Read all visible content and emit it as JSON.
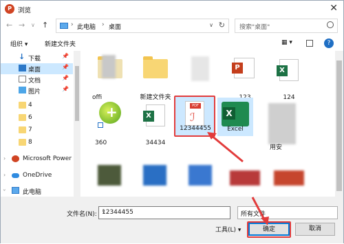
{
  "window": {
    "title": "浏览",
    "app_icon": "P",
    "close": "✕"
  },
  "address": {
    "back": "←",
    "forward": "→",
    "up_dropdown": "∨",
    "up": "↑",
    "crumbs": [
      "此电脑",
      "桌面"
    ],
    "sep": "›",
    "search_placeholder": "搜索\"桌面\""
  },
  "toolbar": {
    "organize": "组织 ▾",
    "new_folder": "新建文件夹",
    "view": "▦ ▾"
  },
  "sidebar": {
    "items": [
      {
        "label": "下载",
        "pinned": true
      },
      {
        "label": "桌面",
        "pinned": true,
        "selected": true
      },
      {
        "label": "文档",
        "pinned": true
      },
      {
        "label": "图片",
        "pinned": true
      },
      {
        "label": "4"
      },
      {
        "label": "6"
      },
      {
        "label": "7"
      },
      {
        "label": "8"
      },
      {
        "label": "Microsoft Power"
      },
      {
        "label": "OneDrive"
      },
      {
        "label": "此电脑"
      }
    ]
  },
  "files": [
    {
      "label": "offi"
    },
    {
      "label": "新建文件夹"
    },
    {
      "label": ""
    },
    {
      "label": "123"
    },
    {
      "label": "124"
    },
    {
      "label": "360"
    },
    {
      "label": "34434"
    },
    {
      "label": "12344455",
      "selected": true
    },
    {
      "label": "Excel"
    },
    {
      "label": "用安"
    }
  ],
  "bottom": {
    "filename_label": "文件名(N):",
    "filename_value": "12344455",
    "filter": "所有文件",
    "tools": "工具(L) ▾",
    "ok": "确定",
    "cancel": "取消"
  }
}
